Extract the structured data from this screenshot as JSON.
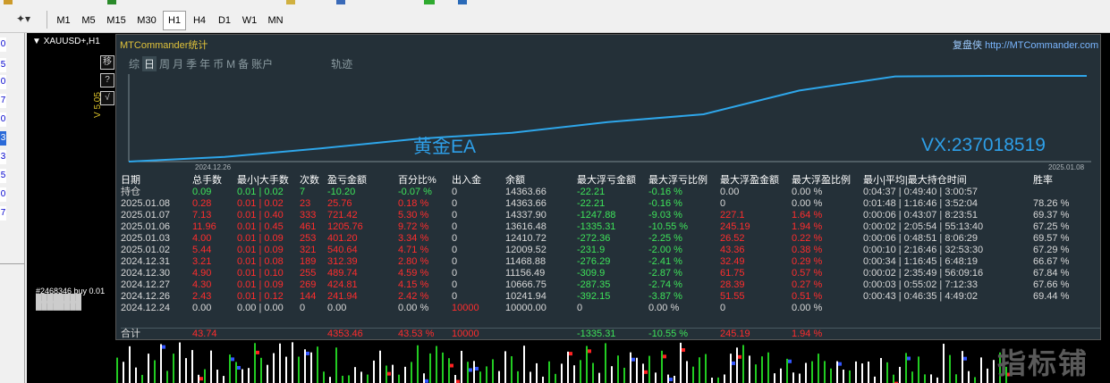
{
  "toolbar": {
    "timeframes": [
      "M1",
      "M5",
      "M15",
      "M30",
      "H1",
      "H4",
      "D1",
      "W1",
      "MN"
    ],
    "active": "H1"
  },
  "leftstrip": {
    "digits": [
      "0",
      "5",
      "0",
      "7",
      "0",
      "3",
      "3",
      "5",
      "0",
      "7"
    ]
  },
  "chart": {
    "title": "XAUUSD+,H1"
  },
  "side_buttons": [
    "移",
    "?",
    "√"
  ],
  "version": "V 5.05",
  "panel": {
    "title": "MTCommander统计",
    "site_label": "复盘侠",
    "site_url": "http://MTCommander.com",
    "tabs": [
      "综",
      "日",
      "周",
      "月",
      "季",
      "年",
      "币",
      "M",
      "备",
      "账户",
      "轨迹"
    ],
    "selected_tab": "日"
  },
  "graph": {
    "start_label": "2024.12.26",
    "end_label": "2025.01.08",
    "watermark_left": "黄金EA",
    "watermark_right": "VX:237018519",
    "balances": [
      10000.0,
      10241.94,
      10666.75,
      11156.49,
      11468.88,
      12009.52,
      12410.72,
      13616.48,
      14337.9,
      14363.66,
      14363.66
    ]
  },
  "table": {
    "headers": [
      "日期",
      "总手数",
      "最小|大手数",
      "次数",
      "盈亏金额",
      "百分比%",
      "出入金",
      "余额",
      "最大浮亏金额",
      "最大浮亏比例",
      "最大浮盈金额",
      "最大浮盈比例",
      "最小|平均|最大持仓时间",
      "胜率"
    ],
    "holding": {
      "label": "持仓",
      "lots": "0.09",
      "minmax": "0.01 | 0.02",
      "count": "7",
      "pnl": "-10.20",
      "pct": "-0.07 %",
      "io": "0",
      "balance": "14363.66",
      "maxdd": "-22.21",
      "maxddpct": "-0.16 %",
      "maxfp": "0.00",
      "maxfppct": "0.00 %",
      "time": "0:04:37 | 0:49:40 | 3:00:57",
      "win": ""
    },
    "rows": [
      {
        "date": "2025.01.08",
        "lots": "0.28",
        "minmax": "0.01 | 0.02",
        "count": "23",
        "pnl": "25.76",
        "pct": "0.18 %",
        "io": "0",
        "balance": "14363.66",
        "maxdd": "-22.21",
        "maxddpct": "-0.16 %",
        "maxfp": "0",
        "maxfppct": "0.00 %",
        "time": "0:01:48 | 1:16:46 | 3:52:04",
        "win": "78.26 %"
      },
      {
        "date": "2025.01.07",
        "lots": "7.13",
        "minmax": "0.01 | 0.40",
        "count": "333",
        "pnl": "721.42",
        "pct": "5.30 %",
        "io": "0",
        "balance": "14337.90",
        "maxdd": "-1247.88",
        "maxddpct": "-9.03 %",
        "maxfp": "227.1",
        "maxfppct": "1.64 %",
        "time": "0:00:06 | 0:43:07 | 8:23:51",
        "win": "69.37 %"
      },
      {
        "date": "2025.01.06",
        "lots": "11.96",
        "minmax": "0.01 | 0.45",
        "count": "461",
        "pnl": "1205.76",
        "pct": "9.72 %",
        "io": "0",
        "balance": "13616.48",
        "maxdd": "-1335.31",
        "maxddpct": "-10.55 %",
        "maxfp": "245.19",
        "maxfppct": "1.94 %",
        "time": "0:00:02 | 2:05:54 | 55:13:40",
        "win": "67.25 %"
      },
      {
        "date": "2025.01.03",
        "lots": "4.00",
        "minmax": "0.01 | 0.09",
        "count": "253",
        "pnl": "401.20",
        "pct": "3.34 %",
        "io": "0",
        "balance": "12410.72",
        "maxdd": "-272.36",
        "maxddpct": "-2.25 %",
        "maxfp": "26.52",
        "maxfppct": "0.22 %",
        "time": "0:00:06 | 0:48:51 | 8:06:29",
        "win": "69.57 %"
      },
      {
        "date": "2025.01.02",
        "lots": "5.44",
        "minmax": "0.01 | 0.09",
        "count": "321",
        "pnl": "540.64",
        "pct": "4.71 %",
        "io": "0",
        "balance": "12009.52",
        "maxdd": "-231.9",
        "maxddpct": "-2.00 %",
        "maxfp": "43.36",
        "maxfppct": "0.38 %",
        "time": "0:00:10 | 2:16:46 | 32:53:30",
        "win": "67.29 %"
      },
      {
        "date": "2024.12.31",
        "lots": "3.21",
        "minmax": "0.01 | 0.08",
        "count": "189",
        "pnl": "312.39",
        "pct": "2.80 %",
        "io": "0",
        "balance": "11468.88",
        "maxdd": "-276.29",
        "maxddpct": "-2.41 %",
        "maxfp": "32.49",
        "maxfppct": "0.29 %",
        "time": "0:00:34 | 1:16:45 | 6:48:19",
        "win": "66.67 %"
      },
      {
        "date": "2024.12.30",
        "lots": "4.90",
        "minmax": "0.01 | 0.10",
        "count": "255",
        "pnl": "489.74",
        "pct": "4.59 %",
        "io": "0",
        "balance": "11156.49",
        "maxdd": "-309.9",
        "maxddpct": "-2.87 %",
        "maxfp": "61.75",
        "maxfppct": "0.57 %",
        "time": "0:00:02 | 2:35:49 | 56:09:16",
        "win": "67.84 %"
      },
      {
        "date": "2024.12.27",
        "lots": "4.30",
        "minmax": "0.01 | 0.09",
        "count": "269",
        "pnl": "424.81",
        "pct": "4.15 %",
        "io": "0",
        "balance": "10666.75",
        "maxdd": "-287.35",
        "maxddpct": "-2.74 %",
        "maxfp": "28.39",
        "maxfppct": "0.27 %",
        "time": "0:00:03 | 0:55:02 | 7:12:33",
        "win": "67.66 %"
      },
      {
        "date": "2024.12.26",
        "lots": "2.43",
        "minmax": "0.01 | 0.12",
        "count": "144",
        "pnl": "241.94",
        "pct": "2.42 %",
        "io": "0",
        "balance": "10241.94",
        "maxdd": "-392.15",
        "maxddpct": "-3.87 %",
        "maxfp": "51.55",
        "maxfppct": "0.51 %",
        "time": "0:00:43 | 0:46:35 | 4:49:02",
        "win": "69.44 %"
      },
      {
        "date": "2024.12.24",
        "lots": "0.00",
        "minmax": "0.00 | 0.00",
        "count": "0",
        "pnl": "0.00",
        "pct": "0.00 %",
        "io": "10000",
        "balance": "10000.00",
        "maxdd": "0",
        "maxddpct": "0.00 %",
        "maxfp": "0",
        "maxfppct": "0.00 %",
        "time": "",
        "win": ""
      }
    ],
    "total": {
      "label": "合计",
      "lots": "43.74",
      "pnl": "4353.46",
      "pct": "43.53 %",
      "io": "10000",
      "maxdd": "-1335.31",
      "maxddpct": "-10.55 %",
      "maxfp": "245.19",
      "maxfppct": "1.94 %"
    }
  },
  "orders_label": "#2468346 buy 0.01",
  "logo_text": "指标铺"
}
